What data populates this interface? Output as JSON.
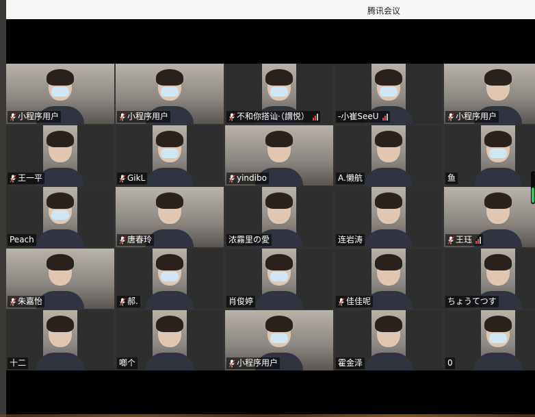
{
  "window": {
    "title": "腾讯会议"
  },
  "participants": [
    {
      "name": "小程序用户",
      "mic": true,
      "signal": false,
      "feed": "full",
      "mask": true
    },
    {
      "name": "小程序用户",
      "mic": true,
      "signal": false,
      "feed": "full",
      "mask": true
    },
    {
      "name": "不和你搭讪·（謂悦）",
      "mic": true,
      "signal": true,
      "feed": "narrow",
      "mask": true
    },
    {
      "name": "-小崔SeeU",
      "mic": false,
      "signal": true,
      "feed": "narrow",
      "mask": true
    },
    {
      "name": "小程序用户",
      "mic": true,
      "signal": false,
      "feed": "full",
      "mask": false
    },
    {
      "name": "王一平",
      "mic": true,
      "signal": false,
      "feed": "narrow",
      "mask": false
    },
    {
      "name": "GikL",
      "mic": true,
      "signal": false,
      "feed": "narrow",
      "mask": true
    },
    {
      "name": "yindibo",
      "mic": true,
      "signal": false,
      "feed": "full",
      "mask": false
    },
    {
      "name": "A.懒航",
      "mic": false,
      "signal": false,
      "feed": "narrow",
      "mask": false
    },
    {
      "name": "鱼",
      "mic": false,
      "signal": false,
      "feed": "narrow",
      "mask": true
    },
    {
      "name": "Peach",
      "mic": false,
      "signal": false,
      "feed": "narrow",
      "mask": true
    },
    {
      "name": "唐春玲",
      "mic": true,
      "signal": false,
      "feed": "full",
      "mask": false
    },
    {
      "name": "浓霧里の愛",
      "mic": false,
      "signal": false,
      "feed": "narrow",
      "mask": false
    },
    {
      "name": "连岩涛",
      "mic": false,
      "signal": false,
      "feed": "narrow",
      "mask": false
    },
    {
      "name": "王珏",
      "mic": true,
      "signal": true,
      "feed": "full",
      "mask": false
    },
    {
      "name": "朱嘉怡",
      "mic": true,
      "signal": false,
      "feed": "full",
      "mask": false
    },
    {
      "name": "郝.",
      "mic": true,
      "signal": false,
      "feed": "narrow",
      "mask": true
    },
    {
      "name": "肖俊婷",
      "mic": false,
      "signal": false,
      "feed": "narrow",
      "mask": true
    },
    {
      "name": "佳佳呢",
      "mic": true,
      "signal": false,
      "feed": "narrow",
      "mask": false
    },
    {
      "name": "ちょうてつす",
      "mic": false,
      "signal": false,
      "feed": "narrow",
      "mask": false
    },
    {
      "name": "十二",
      "mic": false,
      "signal": false,
      "feed": "narrow",
      "mask": false
    },
    {
      "name": "啷个",
      "mic": false,
      "signal": false,
      "feed": "narrow",
      "mask": false
    },
    {
      "name": "小程序用户",
      "mic": true,
      "signal": false,
      "feed": "full",
      "mask": true
    },
    {
      "name": "霍金泽",
      "mic": false,
      "signal": false,
      "feed": "narrow",
      "mask": false
    },
    {
      "name": "0",
      "mic": false,
      "signal": false,
      "feed": "narrow",
      "mask": true
    }
  ],
  "colors": {
    "mic": "#e8453c",
    "label_bg": "rgba(0,0,0,0.55)",
    "volume": "#35c759"
  },
  "volume_level": 0.5
}
